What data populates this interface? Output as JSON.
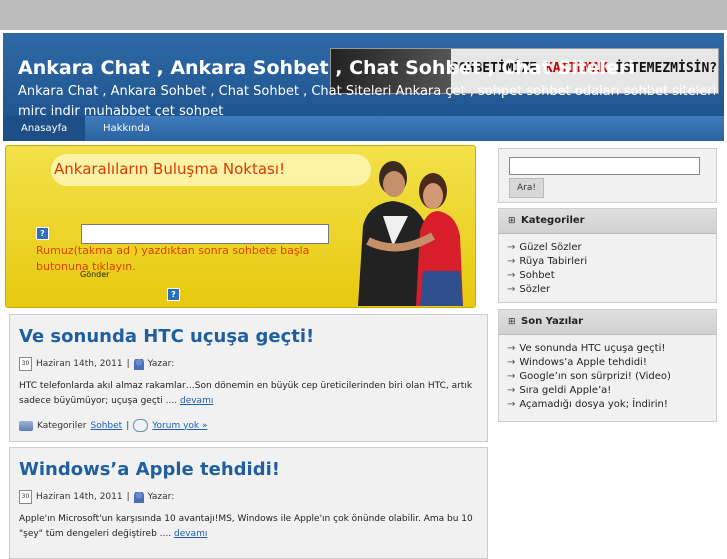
{
  "header": {
    "title": "Ankara Chat , Ankara Sohbet , Chat Sohbet , Chat Siteleri",
    "description": "Ankara Chat , Ankara Sohbet , Chat Sohbet , Chat Siteleri Ankara çet , sohpet sohbet odaları sohbet siteleri mirc indir muhabbet çet sohpet",
    "banner_text_a": "SOHBETİMİZE ",
    "banner_text_b": "KATILMAK",
    "banner_text_c": " İSTEMEZMİSİN?"
  },
  "nav": {
    "items": [
      {
        "label": "Anasayfa"
      },
      {
        "label": "Hakkında"
      }
    ]
  },
  "promo": {
    "title": "Ankaralıların Buluşma Noktası!",
    "hint": "Rumuz(takma ad ) yazdıktan sonra sohbete başla butonuna tıklayın.",
    "button_label": "Gönder",
    "help_glyph": "?"
  },
  "posts": [
    {
      "title": "Ve sonunda HTC uçuşa geçti!",
      "date": "Haziran 14th, 2011",
      "author_label": "Yazar:",
      "excerpt": "HTC telefonlarda akıl almaz rakamlar…Son dönemin en büyük cep üreticilerinden biri olan HTC, artık sadece büyümüyor; uçuşa geçti ....",
      "more": "devamı",
      "categories_label": "Kategoriler",
      "category": "Sohbet",
      "comments": "Yorum yok »"
    },
    {
      "title": "Windows’a Apple tehdidi!",
      "date": "Haziran 14th, 2011",
      "author_label": "Yazar:",
      "excerpt": "Apple'ın Microsoft'un karşısında 10 avantajı!MS, Windows ile Apple'ın çok önünde olabilir. Ama bu 10 \"şey\" tüm dengeleri değiştireb ....",
      "more": "devamı"
    }
  ],
  "sidebar": {
    "search_button": "Ara!",
    "categories_title": "Kategoriler",
    "categories": [
      "Güzel Sözler",
      "Rüya Tabirleri",
      "Sohbet",
      "Sözler"
    ],
    "recent_title": "Son Yazılar",
    "recent": [
      "Ve sonunda HTC uçuşa geçti!",
      "Windows’a Apple tehdidi!",
      "Google’ın son sürprizi! (Video)",
      "Sıra geldi Apple’a!",
      "Açamadığı dosya yok; İndirin!"
    ],
    "arrow_glyph": "→",
    "box_glyph": "⊞"
  },
  "calendar_glyph": "30"
}
